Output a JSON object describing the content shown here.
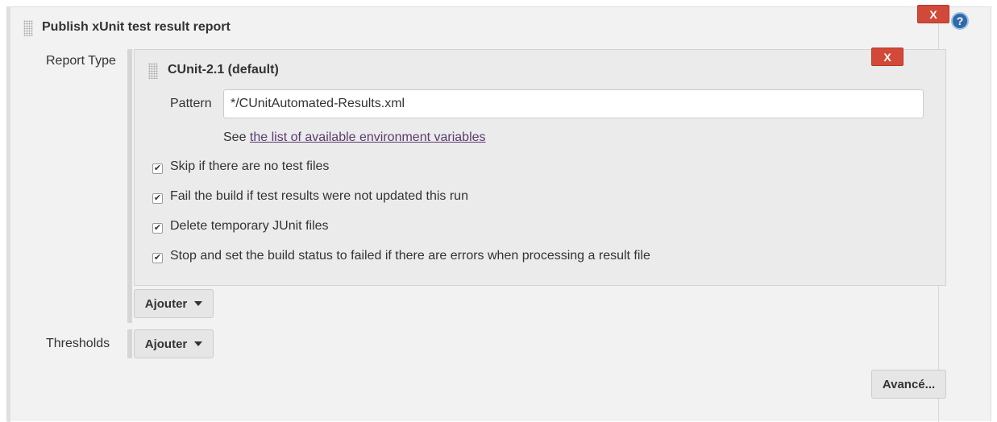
{
  "section": {
    "title": "Publish xUnit test result report",
    "delete_label": "X",
    "help_label": "?"
  },
  "report_type": {
    "label": "Report Type",
    "tool": {
      "title": "CUnit-2.1 (default)",
      "delete_label": "X",
      "pattern": {
        "label": "Pattern",
        "value": "*/CUnitAutomated-Results.xml"
      },
      "env_hint_prefix": "See",
      "env_hint_link": "the list of available environment variables",
      "options": [
        {
          "label": "Skip if there are no test files",
          "checked": true
        },
        {
          "label": "Fail the build if test results were not updated this run",
          "checked": true
        },
        {
          "label": "Delete temporary JUnit files",
          "checked": true
        },
        {
          "label": "Stop and set the build status to failed if there are errors when processing a result file",
          "checked": true
        }
      ]
    },
    "add_button": "Ajouter"
  },
  "thresholds": {
    "label": "Thresholds",
    "add_button": "Ajouter"
  },
  "advanced_button": "Avancé...",
  "colors": {
    "delete_button": "#d24939",
    "help_icon": "#2e69a8",
    "link": "#5b3b6e",
    "panel_bg": "#f2f2f2"
  }
}
